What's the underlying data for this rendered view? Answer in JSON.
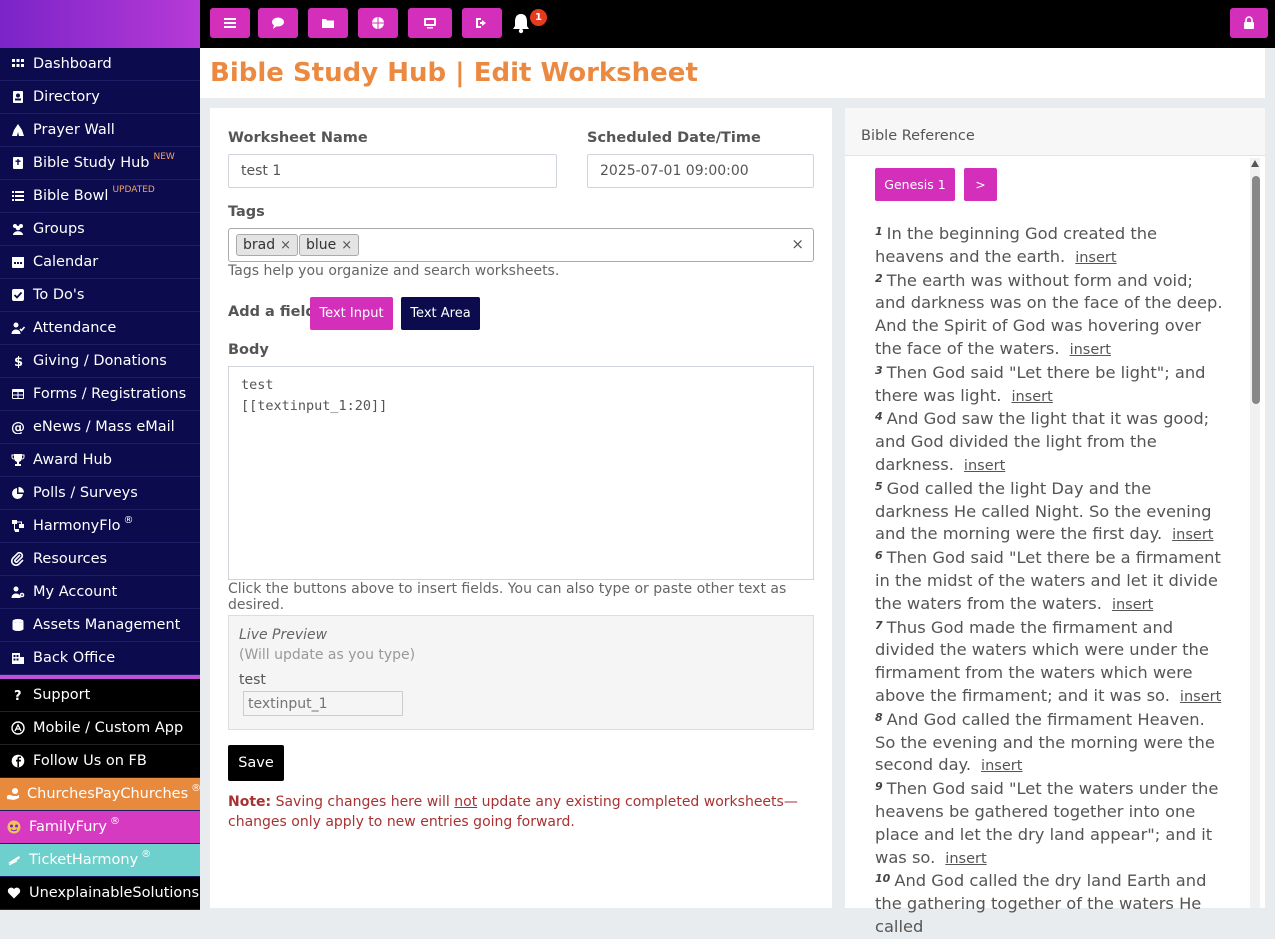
{
  "sidebar": {
    "items": [
      {
        "label": "Dashboard",
        "icon": "grid-icon"
      },
      {
        "label": "Directory",
        "icon": "address-book-icon"
      },
      {
        "label": "Prayer Wall",
        "icon": "praying-hands-icon"
      },
      {
        "label": "Bible Study Hub",
        "icon": "bible-icon",
        "badge": "NEW"
      },
      {
        "label": "Bible Bowl",
        "icon": "list-icon",
        "badge": "UPDATED"
      },
      {
        "label": "Groups",
        "icon": "users-icon"
      },
      {
        "label": "Calendar",
        "icon": "calendar-icon"
      },
      {
        "label": "To Do's",
        "icon": "check-square-icon"
      },
      {
        "label": "Attendance",
        "icon": "user-check-icon"
      },
      {
        "label": "Giving / Donations",
        "icon": "dollar-icon"
      },
      {
        "label": "Forms / Registrations",
        "icon": "table-icon"
      },
      {
        "label": "eNews / Mass eMail",
        "icon": "at-icon"
      },
      {
        "label": "Award Hub",
        "icon": "trophy-icon"
      },
      {
        "label": "Polls / Surveys",
        "icon": "pie-chart-icon"
      },
      {
        "label": "HarmonyFlo",
        "icon": "sitemap-icon",
        "reg": "®"
      },
      {
        "label": "Resources",
        "icon": "paperclip-icon"
      },
      {
        "label": "My Account",
        "icon": "user-cog-icon"
      },
      {
        "label": "Assets Management",
        "icon": "database-icon"
      },
      {
        "label": "Back Office",
        "icon": "building-icon"
      }
    ],
    "support": [
      {
        "label": "Support",
        "icon": "question-icon"
      },
      {
        "label": "Mobile / Custom App",
        "icon": "app-store-icon"
      },
      {
        "label": "Follow Us on FB",
        "icon": "facebook-icon"
      }
    ],
    "partners": [
      {
        "label": "ChurchesPayChurches",
        "reg": "®",
        "icon": "hand-coin-icon"
      },
      {
        "label": "FamilyFury",
        "reg": "®",
        "icon": "familyfury-logo-icon"
      },
      {
        "label": "TicketHarmony",
        "reg": "®",
        "icon": "ticket-wing-icon"
      },
      {
        "label": "UnexplainableSolutions",
        "icon": "heart-icon"
      }
    ]
  },
  "topbar": {
    "buttons": [
      "menu-icon",
      "chat-icon",
      "folder-icon",
      "globe-icon",
      "monitor-icon",
      "sign-out-icon"
    ],
    "notifications": "1",
    "lock": "lock-icon"
  },
  "page": {
    "title": "Bible Study Hub | Edit Worksheet"
  },
  "form": {
    "name_label": "Worksheet Name",
    "name_value": "test 1",
    "date_label": "Scheduled Date/Time",
    "date_value": "2025-07-01 09:00:00",
    "tags_label": "Tags",
    "tags": [
      "brad",
      "blue"
    ],
    "tags_clear": "×",
    "tags_remove": "×",
    "tags_help": "Tags help you organize and search worksheets.",
    "add_field_label": "Add a field:",
    "text_input_btn": "Text Input",
    "text_area_btn": "Text Area",
    "body_label": "Body",
    "body_line1": "test",
    "body_line2": "[[textinput_1:20]]",
    "body_help": "Click the buttons above to insert fields. You can also type or paste other text as desired.",
    "preview_title": "Live Preview",
    "preview_sub": "(Will update as you type)",
    "preview_text": "test",
    "preview_input_placeholder": "textinput_1",
    "save": "Save",
    "note_label": "Note:",
    "note_pre": " Saving changes here will ",
    "note_not": "not",
    "note_post": " update any existing completed worksheets—changes only apply to new entries going forward."
  },
  "bible": {
    "header": "Bible Reference",
    "chapter_btn": "Genesis 1",
    "next_btn": ">",
    "insert_label": "insert",
    "verses": [
      {
        "n": "1",
        "text": "In the beginning God created the heavens and the earth."
      },
      {
        "n": "2",
        "text": "The earth was without form and void; and darkness was on the face of the deep. And the Spirit of God was hovering over the face of the waters."
      },
      {
        "n": "3",
        "text": "Then God said \"Let there be light\"; and there was light."
      },
      {
        "n": "4",
        "text": "And God saw the light that it was good; and God divided the light from the darkness."
      },
      {
        "n": "5",
        "text": "God called the light Day and the darkness He called Night. So the evening and the morning were the first day."
      },
      {
        "n": "6",
        "text": "Then God said \"Let there be a firmament in the midst of the waters and let it divide the waters from the waters."
      },
      {
        "n": "7",
        "text": "Thus God made the firmament and divided the waters which were under the firmament from the waters which were above the firmament; and it was so."
      },
      {
        "n": "8",
        "text": "And God called the firmament Heaven. So the evening and the morning were the second day."
      },
      {
        "n": "9",
        "text": "Then God said \"Let the waters under the heavens be gathered together into one place and let the dry land appear\"; and it was so."
      },
      {
        "n": "10",
        "text": "And God called the dry land Earth and the gathering together of the waters He called"
      }
    ]
  }
}
